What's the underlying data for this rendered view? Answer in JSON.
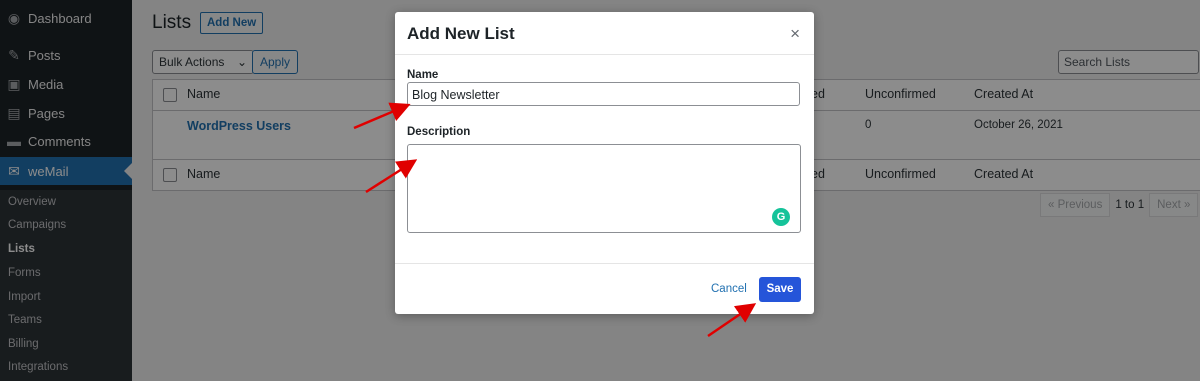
{
  "sidebar": {
    "items": [
      {
        "label": "Dashboard",
        "icon": "dashboard-icon"
      },
      {
        "label": "Posts",
        "icon": "pin-icon"
      },
      {
        "label": "Media",
        "icon": "media-icon"
      },
      {
        "label": "Pages",
        "icon": "pages-icon"
      },
      {
        "label": "Comments",
        "icon": "comments-icon"
      },
      {
        "label": "weMail",
        "icon": "envelope-icon"
      }
    ],
    "submenu": [
      "Overview",
      "Campaigns",
      "Lists",
      "Forms",
      "Import",
      "Teams",
      "Billing",
      "Integrations"
    ]
  },
  "page": {
    "title": "Lists",
    "add_new": "Add New",
    "bulk_actions": "Bulk Actions",
    "apply": "Apply",
    "search_placeholder": "Search Lists"
  },
  "table": {
    "columns": [
      "Name",
      "ed",
      "Unconfirmed",
      "Created At"
    ],
    "rows": [
      {
        "name": "WordPress Users",
        "unconfirmed": "0",
        "created": "October 26, 2021"
      }
    ]
  },
  "pagination": {
    "prev": "« Previous",
    "info": "1 to 1",
    "next": "Next »"
  },
  "modal": {
    "title": "Add New List",
    "close": "×",
    "name_label": "Name",
    "name_value": "Blog Newsletter",
    "description_label": "Description",
    "description_value": "",
    "grammarly": "G",
    "cancel": "Cancel",
    "save": "Save"
  },
  "colors": {
    "accent": "#2271b1",
    "save": "#2555d9",
    "sidebar": "#1d2327",
    "annotation": "#e00000"
  }
}
